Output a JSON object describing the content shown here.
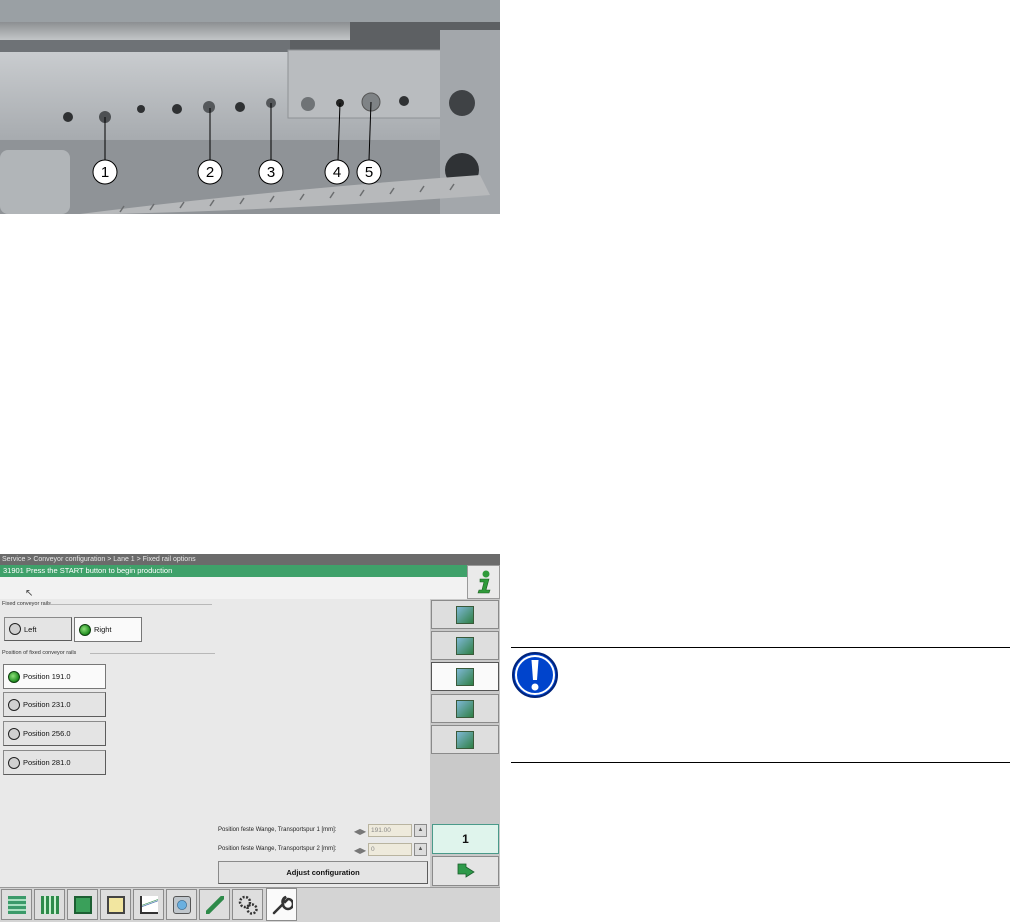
{
  "photo": {
    "callouts": [
      "1",
      "2",
      "3",
      "4",
      "5"
    ]
  },
  "screen": {
    "breadcrumb": "Service > Conveyor configuration > Lane 1 > Fixed rail options",
    "status_message": "31901 Press the START button to begin production",
    "fixed_rails_group": {
      "label": "Fixed conveyor rails",
      "options": [
        {
          "label": "Left",
          "on": false
        },
        {
          "label": "Right",
          "on": true
        }
      ]
    },
    "position_group": {
      "label": "Position of fixed conveyor rails",
      "options": [
        {
          "label": "Position 191.0",
          "on": true
        },
        {
          "label": "Position 231.0",
          "on": false
        },
        {
          "label": "Position 256.0",
          "on": false
        },
        {
          "label": "Position 281.0",
          "on": false
        }
      ]
    },
    "fields": [
      {
        "label": "Position feste Wange, Transportspur 1 [mm]:",
        "value": "191.00"
      },
      {
        "label": "Position feste Wange, Transportspur 2 [mm]:",
        "value": "0"
      }
    ],
    "adjust_label": "Adjust configuration",
    "lane_number": "1",
    "taskbar_icons": [
      "layers-icon",
      "grid-icon",
      "board-icon",
      "feeder-icon",
      "chart-icon",
      "camera-icon",
      "tool-icon",
      "gears-icon",
      "wrench-icon"
    ],
    "sidebar_icons": [
      "rail-adjust-icon",
      "rail-width-icon",
      "fixed-rail-icon",
      "rail-move-icon",
      "rail-calibrate-icon"
    ]
  },
  "colors": {
    "status_green": "#3fa16a",
    "led_green": "#1c8a1c",
    "warning_blue": "#0044cc"
  }
}
